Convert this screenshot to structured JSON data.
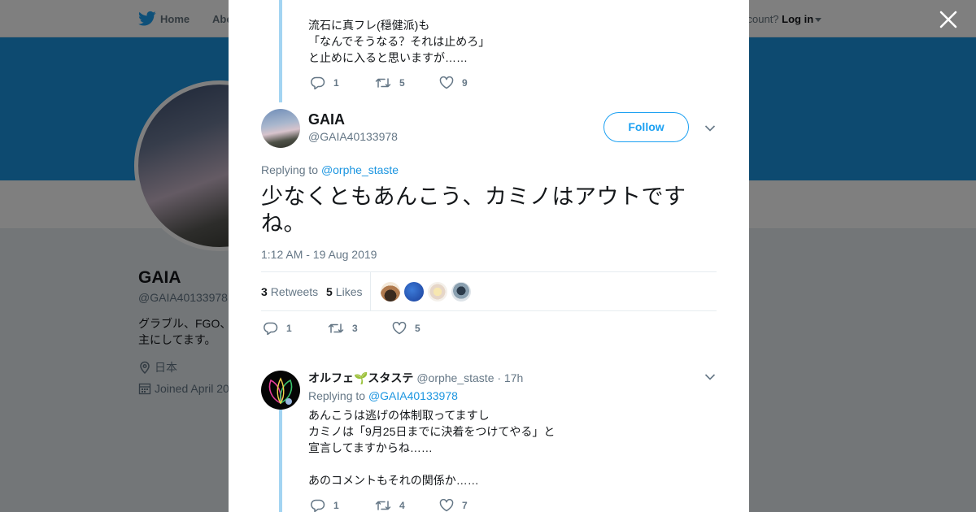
{
  "nav": {
    "home_label": "Home",
    "about_label": "Abo",
    "account_prompt": "ccount?",
    "login_label": "Log in"
  },
  "profile": {
    "name": "GAIA",
    "handle": "@GAIA40133978",
    "bio_line1": "グラブル、FGO、",
    "bio_line2": "主にしてます。",
    "location": "日本",
    "joined": "Joined April 20"
  },
  "previous_tweet": {
    "lines": [
      "流石に真フレ(穏健派)も",
      "「なんでそうなる？それは止めろ」",
      "と止めに入ると思いますが……"
    ],
    "reply_count": "1",
    "retweet_count": "5",
    "like_count": "9"
  },
  "main_tweet": {
    "name": "GAIA",
    "handle": "@GAIA40133978",
    "follow_label": "Follow",
    "replying_prefix": "Replying to",
    "replying_to": "@orphe_staste",
    "text_line1": "少なくともあんこう、カミノはアウトです",
    "text_line2": "ね。",
    "timestamp": "1:12 AM - 19 Aug 2019",
    "retweets_count": "3",
    "retweets_label": "Retweets",
    "likes_count": "5",
    "likes_label": "Likes",
    "reply_count": "1",
    "retweet_count": "3",
    "like_count": "5"
  },
  "reply_tweet": {
    "name": "オルフェ🌱スタステ",
    "handle": "@orphe_staste",
    "age": "· 17h",
    "replying_prefix": "Replying to",
    "replying_to": "@GAIA40133978",
    "lines": [
      "あんこうは逃げの体制取ってますし",
      "カミノは「9月25日までに決着をつけてやる」と",
      "宣言してますからね……",
      "",
      "あのコメントもそれの関係か……"
    ],
    "reply_count": "1",
    "retweet_count": "4",
    "like_count": "7"
  },
  "colors": {
    "accent": "#1da1f2",
    "link": "#1b95e0",
    "thread_line": "#a3d4f2",
    "muted": "#657786",
    "banner": "#1b95e0"
  },
  "icons": [
    "twitter-bird-icon",
    "close-icon",
    "reply-icon",
    "retweet-icon",
    "like-icon",
    "chevron-down-icon",
    "location-icon",
    "calendar-icon"
  ]
}
